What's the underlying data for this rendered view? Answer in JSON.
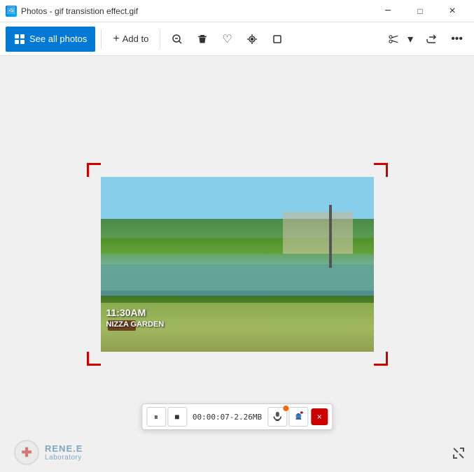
{
  "window": {
    "title": "Photos - gif transistion effect.gif",
    "icon": "🖼"
  },
  "titlebar": {
    "minimize_label": "−",
    "maximize_label": "□",
    "close_label": "×"
  },
  "toolbar": {
    "see_all_label": "See all photos",
    "add_to_label": "Add to",
    "zoom_out_label": "−",
    "delete_label": "🗑",
    "heart_label": "♡",
    "enhance_label": "⊙",
    "crop_label": "⊡",
    "edit_label": "✂",
    "share_label": "↗",
    "more_label": "…"
  },
  "photo": {
    "time": "11:30AM",
    "location": "NIZZA GARDEN"
  },
  "recording": {
    "pause_icon": "⏸",
    "stop_icon": "■",
    "timer": "00:00:07-2.26MB",
    "mic_icon": "🎤",
    "cam_icon": "👤",
    "close_icon": "×"
  },
  "watermark": {
    "name": "RENE.E",
    "subtitle": "Laboratory"
  }
}
